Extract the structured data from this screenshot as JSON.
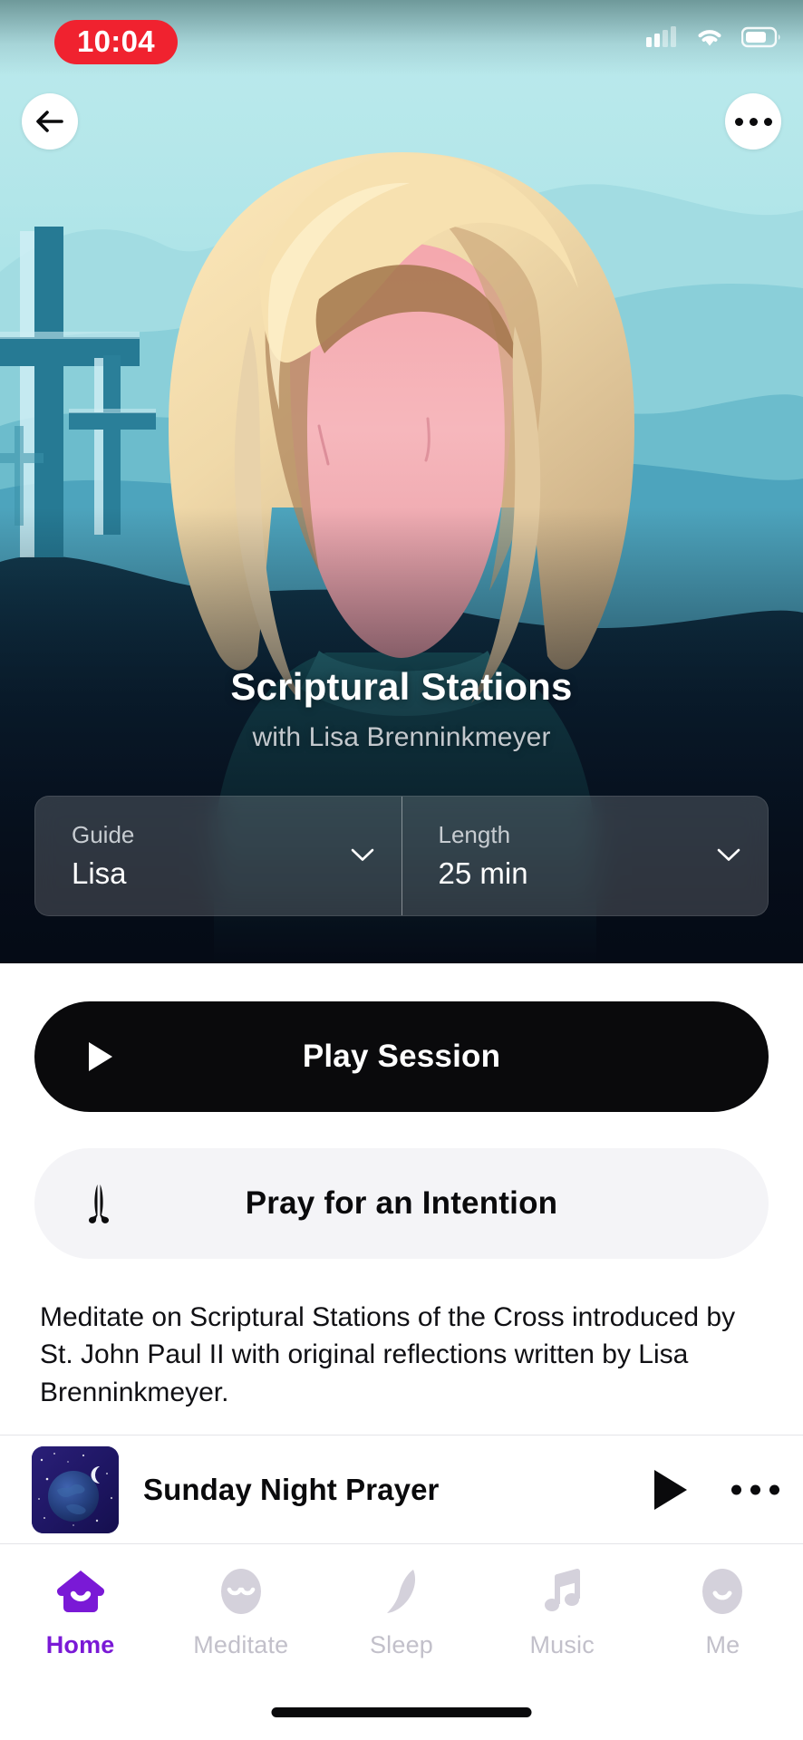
{
  "status_bar": {
    "time": "10:04",
    "time_pill_color": "#f0222f",
    "icons": [
      "cellular-signal-icon",
      "wifi-icon",
      "battery-icon"
    ]
  },
  "nav": {
    "back_icon": "back-arrow-icon",
    "more_icon": "more-options-icon"
  },
  "hero": {
    "title": "Scriptural Stations",
    "subtitle": "with Lisa Brenninkmeyer",
    "background_top_color": "#b9e9ec",
    "background_bottom_color": "#060e1a",
    "illustration": "woman-with-crosses-illustration"
  },
  "selectors": [
    {
      "label": "Guide",
      "value": "Lisa",
      "icon": "chevron-down-icon"
    },
    {
      "label": "Length",
      "value": "25 min",
      "icon": "chevron-down-icon"
    }
  ],
  "actions": {
    "play": {
      "label": "Play Session",
      "icon": "play-icon",
      "bg_color": "#0a0a0c",
      "text_color": "#ffffff"
    },
    "pray": {
      "label": "Pray for an Intention",
      "icon": "praying-hands-icon",
      "bg_color": "#f4f4f7",
      "text_color": "#0a0a0c"
    }
  },
  "description": "Meditate on Scriptural Stations of the Cross introduced by St. John Paul II with original reflections written by Lisa Brenninkmeyer.",
  "mini_player": {
    "title": "Sunday Night Prayer",
    "thumbnail": "night-earth-moon-artwork",
    "play_icon": "play-icon",
    "more_icon": "more-options-icon"
  },
  "tab_bar": {
    "active_color": "#7A19D6",
    "inactive_color": "#c2c0ca",
    "tabs": [
      {
        "label": "Home",
        "icon": "home-icon",
        "active": true
      },
      {
        "label": "Meditate",
        "icon": "meditate-face-icon",
        "active": false
      },
      {
        "label": "Sleep",
        "icon": "moon-icon",
        "active": false
      },
      {
        "label": "Music",
        "icon": "music-note-icon",
        "active": false
      },
      {
        "label": "Me",
        "icon": "profile-face-icon",
        "active": false
      }
    ]
  }
}
